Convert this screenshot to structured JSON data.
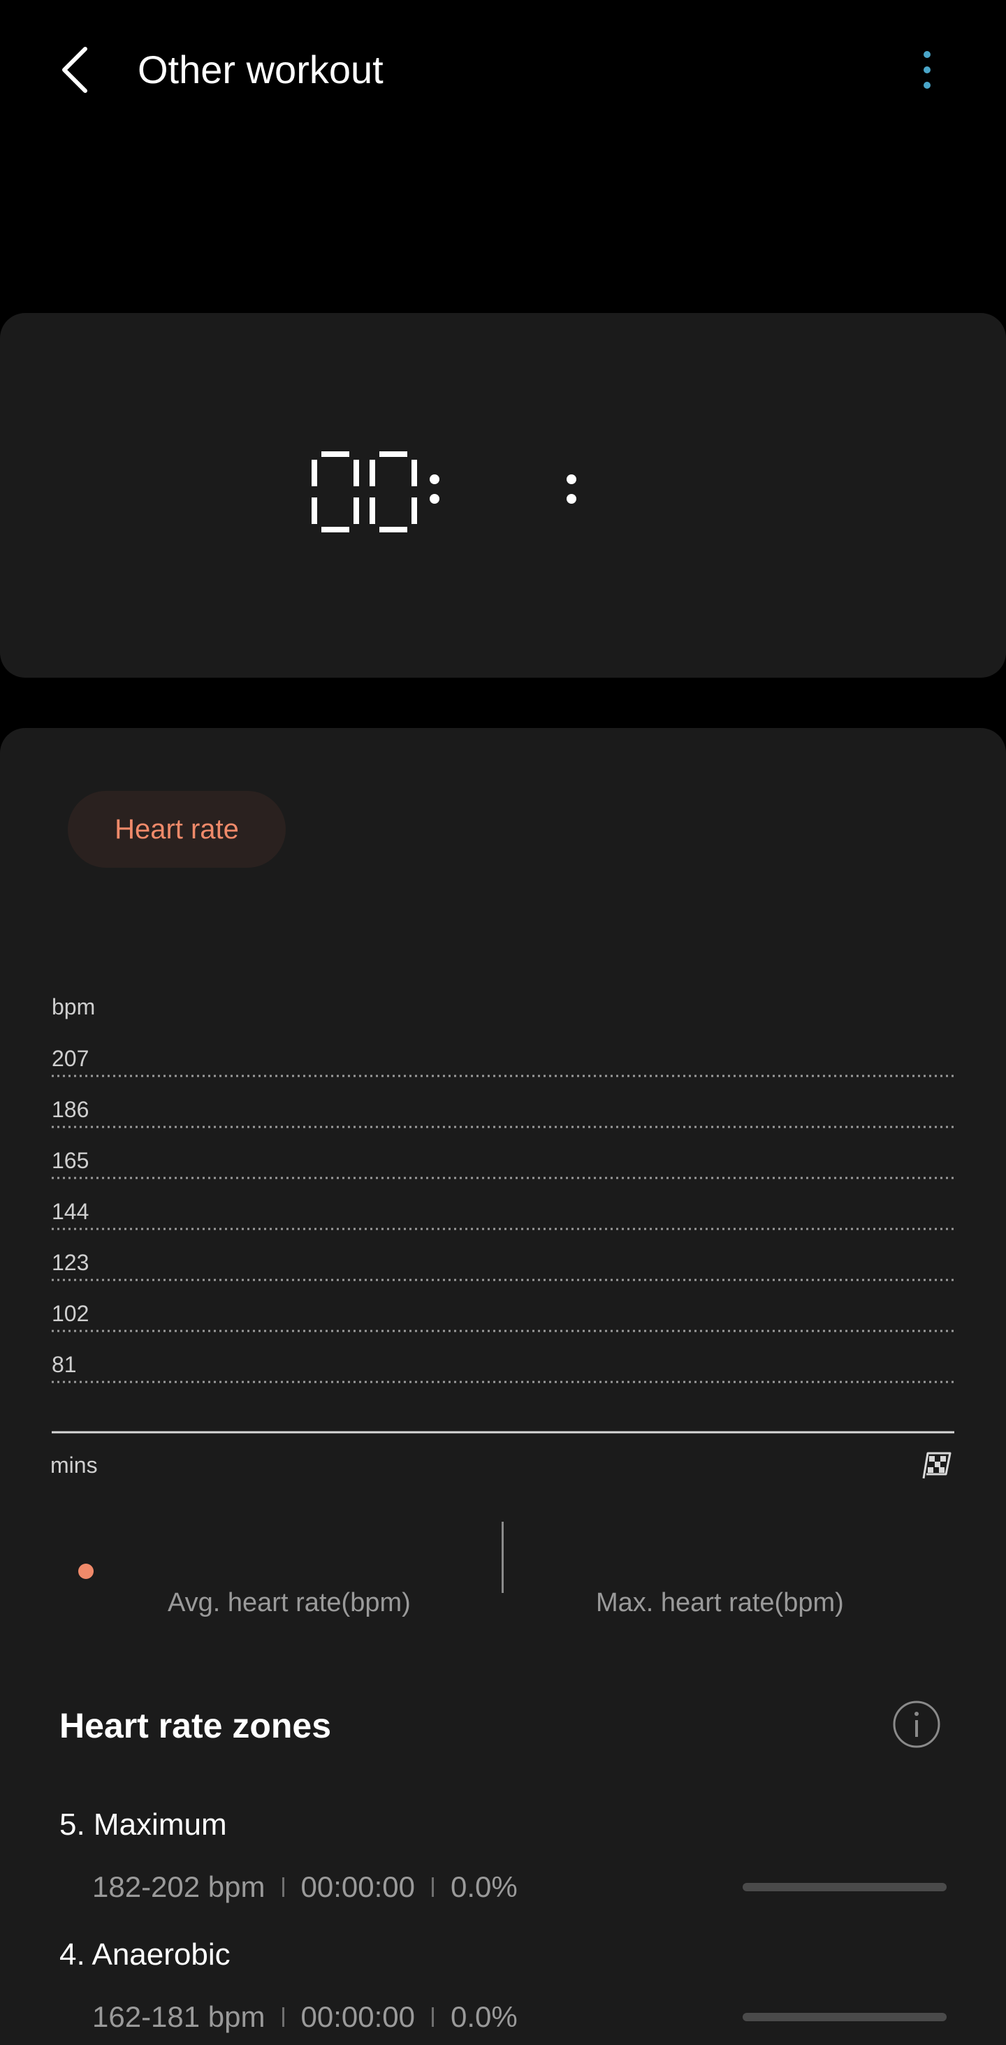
{
  "header": {
    "title": "Other workout",
    "back_icon": "back-arrow-icon",
    "more_icon": "more-vert-icon",
    "accent": "#4aa6c9"
  },
  "timer": {
    "hours": "00",
    "separator_1": ":",
    "separator_2": ":"
  },
  "tabs": [
    {
      "label": "Heart rate",
      "color": "#f08a6a"
    }
  ],
  "chart_data": {
    "type": "line",
    "ylabel": "bpm",
    "xlabel": "mins",
    "yticks": [
      207,
      186,
      165,
      144,
      123,
      102,
      81
    ],
    "ylim": [
      81,
      207
    ],
    "series": [],
    "grid": true,
    "end_marker_icon": "checkered-flag-icon"
  },
  "stats": {
    "avg_label": "Avg. heart rate(bpm)",
    "max_label": "Max. heart rate(bpm)",
    "legend_color": "#f08a6a"
  },
  "zones": {
    "title": "Heart rate zones",
    "info_icon": "info-icon",
    "items": [
      {
        "name": "5. Maximum",
        "range": "182-202 bpm",
        "time": "00:00:00",
        "percent": "0.0%",
        "fraction": 0.0
      },
      {
        "name": "4. Anaerobic",
        "range": "162-181 bpm",
        "time": "00:00:00",
        "percent": "0.0%",
        "fraction": 0.0
      }
    ]
  }
}
